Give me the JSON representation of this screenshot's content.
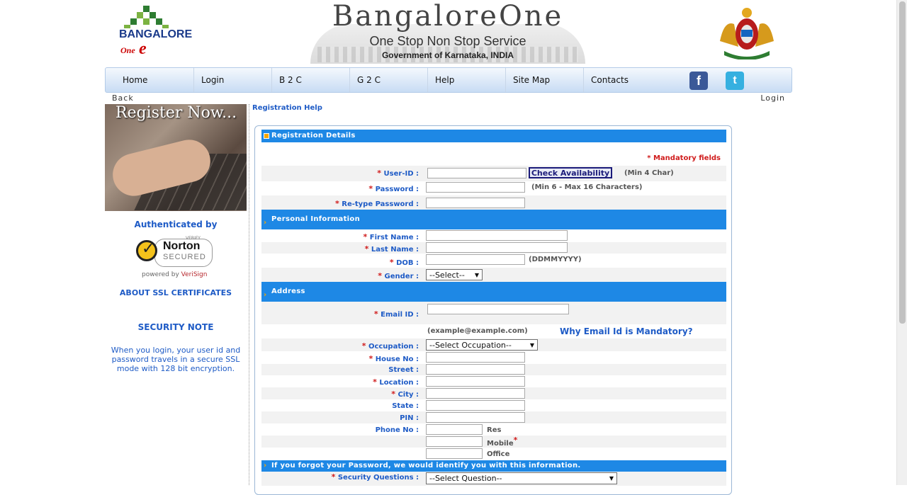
{
  "header": {
    "logo_left_text": "BANGALORE",
    "logo_left_sub": "One",
    "title": "BangaloreOne",
    "tagline": "One Stop Non Stop Service",
    "gov": "Government of Karnataka, INDIA"
  },
  "nav": {
    "items": [
      "Home",
      "Login",
      "B 2 C",
      "G 2 C",
      "Help",
      "Site Map",
      "Contacts"
    ],
    "facebook": "f",
    "twitter": "t"
  },
  "topbar": {
    "back": "Back",
    "login": "Login"
  },
  "sidebar": {
    "register_text": "Register Now...",
    "authenticated": "Authenticated by",
    "norton_name": "Norton",
    "norton_secured": "SECURED",
    "norton_verify": "VERIFY",
    "powered_prefix": "powered by ",
    "powered_brand": "VeriSign",
    "ssl_link": "ABOUT SSL CERTIFICATES",
    "security_note": "SECURITY NOTE",
    "security_desc": "When you login, your user id and password travels in a secure SSL mode with 128 bit encryption."
  },
  "form": {
    "help_link": "Registration Help",
    "section_registration": "Registration Details",
    "mandatory": "* Mandatory fields",
    "user_id_label": "User-ID :",
    "check_button": "Check Availability",
    "user_id_hint": "(Min 4 Char)",
    "password_label": "Password :",
    "password_hint": "(Min 6 - Max 16 Characters)",
    "retype_label": "Re-type Password :",
    "section_personal": "Personal Information",
    "first_name_label": "First Name :",
    "last_name_label": "Last Name :",
    "dob_label": "DOB :",
    "dob_hint": "(DDMMYYYY)",
    "gender_label": "Gender :",
    "gender_value": "--Select--",
    "section_address": "Address",
    "email_label": "Email ID :",
    "email_hint": "(example@example.com)",
    "why_email": "Why Email Id is Mandatory?",
    "occupation_label": "Occupation :",
    "occupation_value": "--Select Occupation--",
    "house_label": "House No :",
    "street_label": "Street :",
    "location_label": "Location :",
    "city_label": "City :",
    "state_label": "State :",
    "pin_label": "PIN :",
    "phone_label": "Phone No :",
    "phone_res": "Res",
    "phone_mobile": "Mobile",
    "phone_office": "Office",
    "section_forgot": "If you forgot your Password, we would identify you with this information.",
    "security_q_label": "Security Questions :",
    "security_q_value": "--Select Question--",
    "required_mark": "*"
  },
  "colors": {
    "link_blue": "#1e5bc6",
    "section_blue": "#1e88e5",
    "required_red": "#d01c1c"
  }
}
